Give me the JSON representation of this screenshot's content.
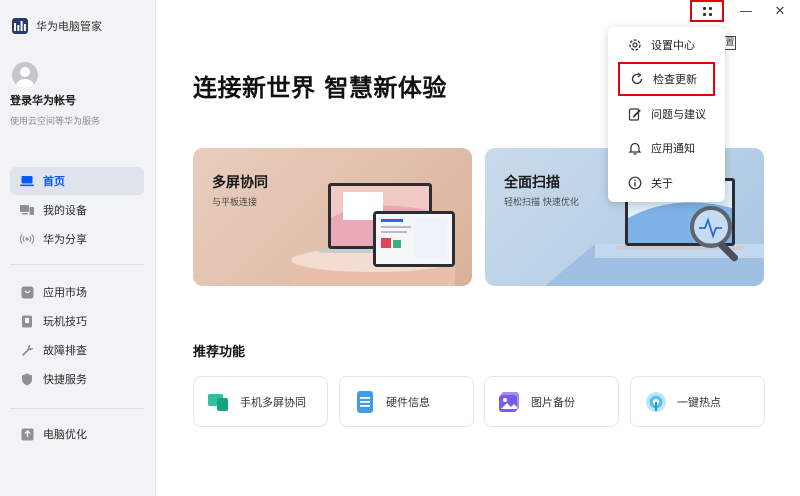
{
  "app": {
    "title": "华为电脑管家"
  },
  "account": {
    "title": "登录华为帐号",
    "subtitle": "使用云空间等华为服务"
  },
  "sidebar": {
    "group1": [
      {
        "label": "首页",
        "icon": "laptop-icon",
        "active": true
      },
      {
        "label": "我的设备",
        "icon": "devices-icon",
        "active": false
      },
      {
        "label": "华为分享",
        "icon": "share-icon",
        "active": false
      }
    ],
    "group2": [
      {
        "label": "应用市场",
        "icon": "app-market-icon"
      },
      {
        "label": "玩机技巧",
        "icon": "tips-icon"
      },
      {
        "label": "故障排查",
        "icon": "wrench-icon"
      },
      {
        "label": "快捷服务",
        "icon": "shield-icon"
      }
    ],
    "group3": [
      {
        "label": "电脑优化",
        "icon": "optimize-icon"
      }
    ]
  },
  "hero": {
    "title": "连接新世界 智慧新体验"
  },
  "cards": [
    {
      "title": "多屏协同",
      "subtitle": "与平板连接"
    },
    {
      "title": "全面扫描",
      "subtitle": "轻松扫描 快速优化"
    }
  ],
  "recommend": {
    "title": "推荐功能",
    "items": [
      {
        "label": "手机多屏协同",
        "icon": "phone-collab-icon"
      },
      {
        "label": "硬件信息",
        "icon": "hardware-info-icon"
      },
      {
        "label": "图片备份",
        "icon": "photo-backup-icon"
      },
      {
        "label": "一键热点",
        "icon": "hotspot-icon"
      }
    ]
  },
  "menu": {
    "items": [
      {
        "label": "设置中心",
        "icon": "gear-icon"
      },
      {
        "label": "检查更新",
        "icon": "refresh-icon",
        "highlighted": true
      },
      {
        "label": "问题与建议",
        "icon": "feedback-icon"
      },
      {
        "label": "应用通知",
        "icon": "bell-icon"
      },
      {
        "label": "关于",
        "icon": "info-icon"
      }
    ],
    "partial_text": "置"
  },
  "window": {
    "minimize_glyph": "—",
    "close_glyph": "✕"
  },
  "colors": {
    "accent": "#0a59f7",
    "highlight": "#e8000b",
    "sidebar_bg": "#f1f3f5"
  }
}
